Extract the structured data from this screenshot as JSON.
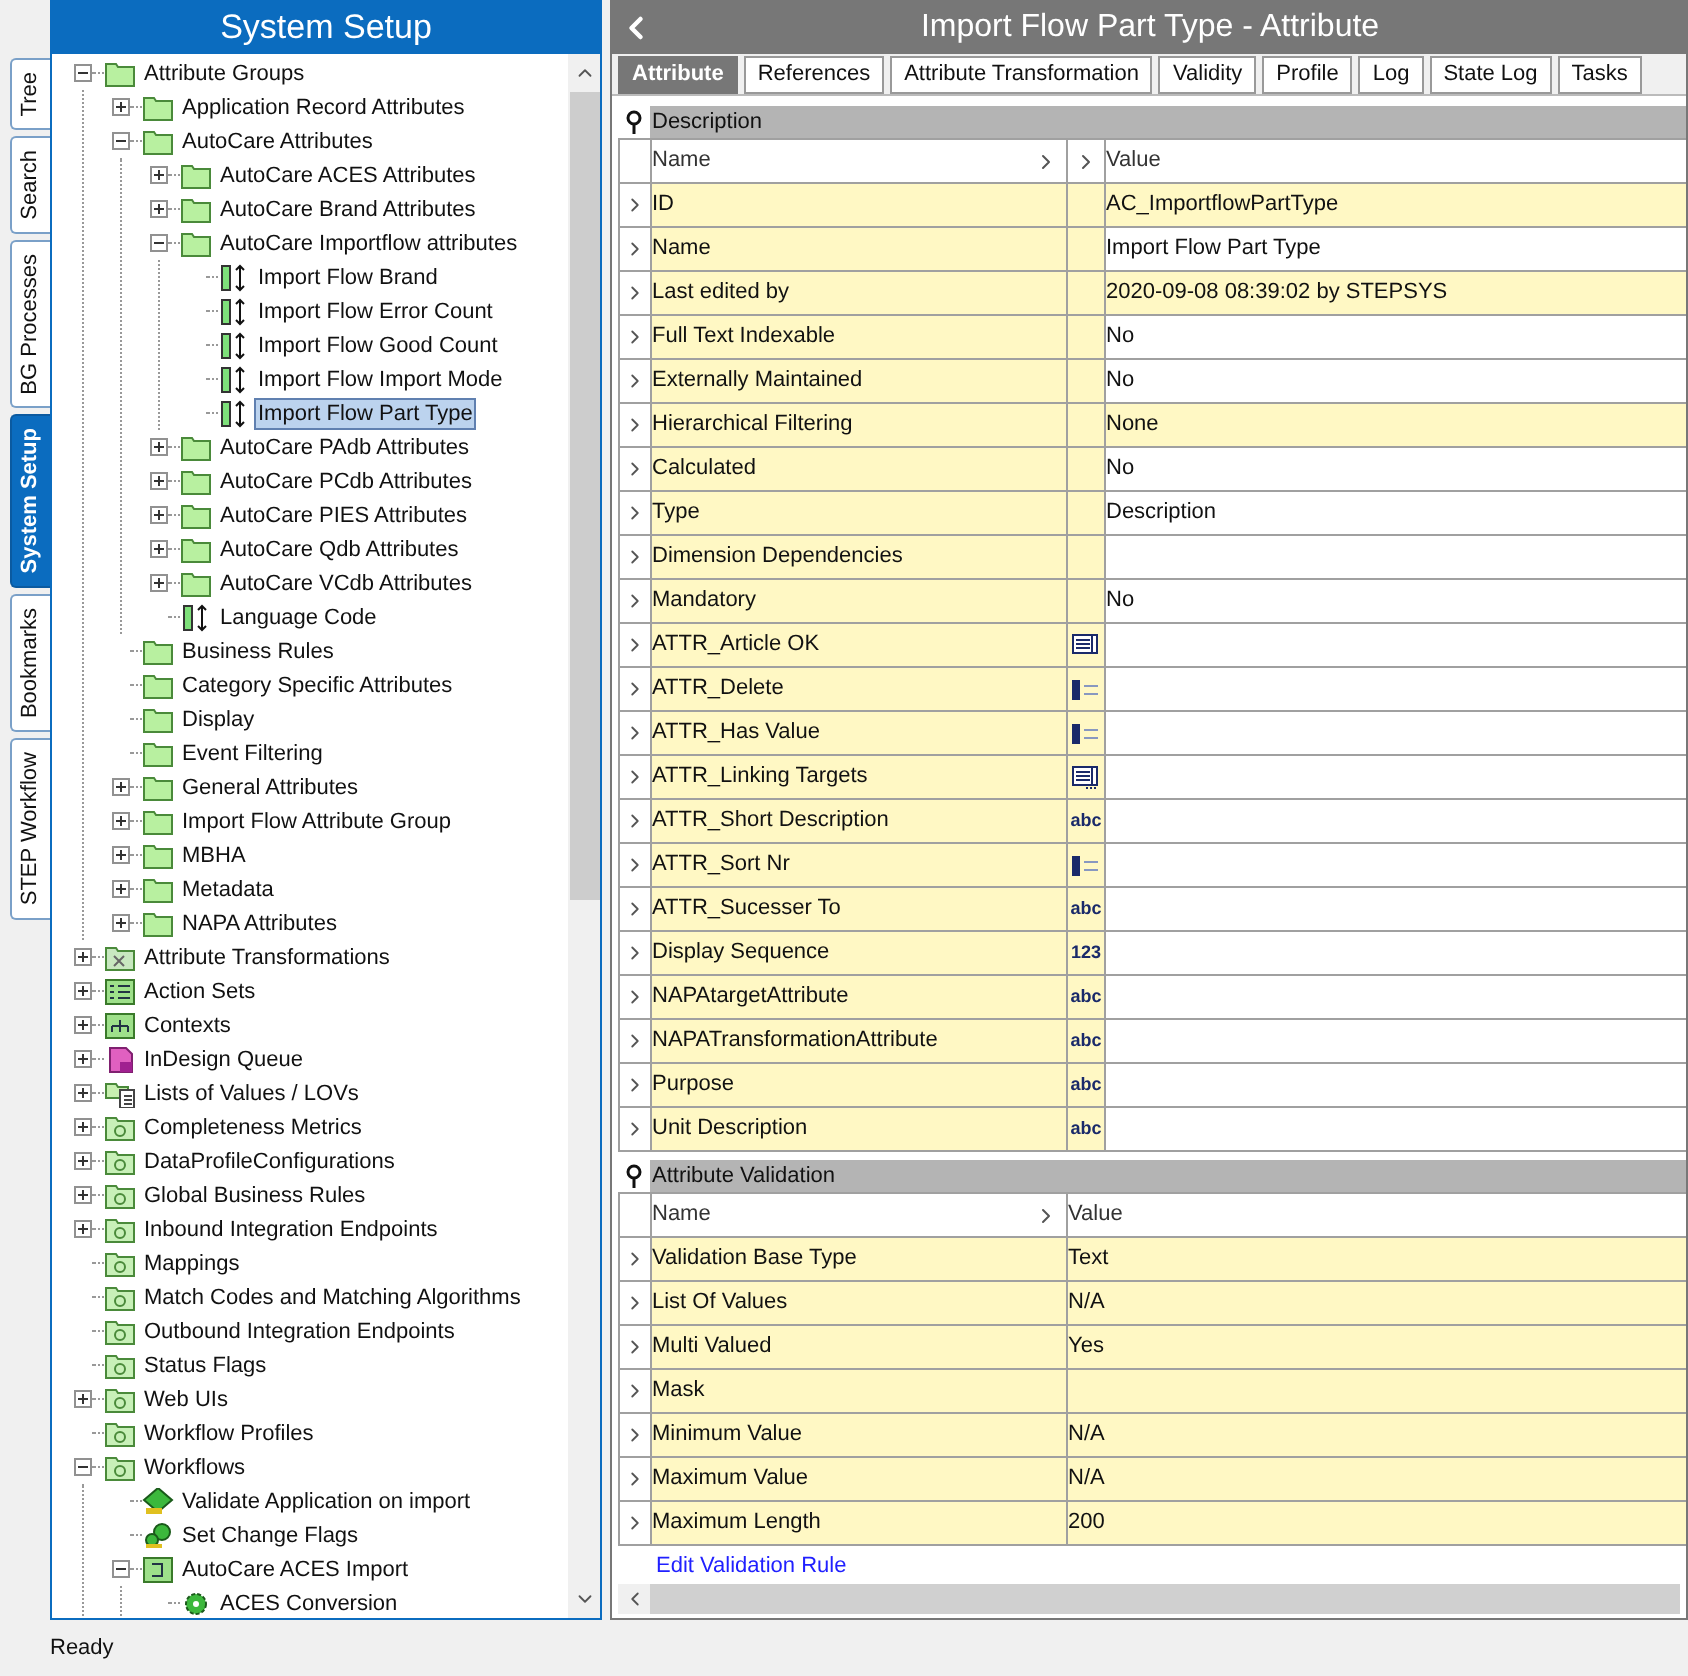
{
  "side_tabs": [
    {
      "label": "Tree",
      "selected": false
    },
    {
      "label": "Search",
      "selected": false
    },
    {
      "label": "BG Processes",
      "selected": false
    },
    {
      "label": "System Setup",
      "selected": true
    },
    {
      "label": "Bookmarks",
      "selected": false
    },
    {
      "label": "STEP Workflow",
      "selected": false
    }
  ],
  "tree_panel": {
    "title": "System Setup"
  },
  "tree": [
    {
      "label": "Attribute Groups",
      "kind": "folder",
      "expanded": true,
      "selected": false,
      "children": [
        {
          "label": "Application Record Attributes",
          "kind": "folder",
          "expanded": false,
          "selected": false
        },
        {
          "label": "AutoCare Attributes",
          "kind": "folder",
          "expanded": true,
          "selected": false,
          "children": [
            {
              "label": "AutoCare ACES Attributes",
              "kind": "folder",
              "expanded": false,
              "selected": false
            },
            {
              "label": "AutoCare Brand Attributes",
              "kind": "folder",
              "expanded": false,
              "selected": false
            },
            {
              "label": "AutoCare Importflow attributes",
              "kind": "folder",
              "expanded": true,
              "selected": false,
              "children": [
                {
                  "label": "Import Flow Brand",
                  "kind": "attribute",
                  "selected": false
                },
                {
                  "label": "Import Flow Error Count",
                  "kind": "attribute",
                  "selected": false
                },
                {
                  "label": "Import Flow Good Count",
                  "kind": "attribute",
                  "selected": false
                },
                {
                  "label": "Import Flow Import Mode",
                  "kind": "attribute",
                  "selected": false
                },
                {
                  "label": "Import Flow Part Type",
                  "kind": "attribute",
                  "selected": true
                }
              ]
            },
            {
              "label": "AutoCare PAdb Attributes",
              "kind": "folder",
              "expanded": false,
              "selected": false
            },
            {
              "label": "AutoCare PCdb Attributes",
              "kind": "folder",
              "expanded": false,
              "selected": false
            },
            {
              "label": "AutoCare PIES Attributes",
              "kind": "folder",
              "expanded": false,
              "selected": false
            },
            {
              "label": "AutoCare Qdb Attributes",
              "kind": "folder",
              "expanded": false,
              "selected": false
            },
            {
              "label": "AutoCare VCdb Attributes",
              "kind": "folder",
              "expanded": false,
              "selected": false
            },
            {
              "label": "Language Code",
              "kind": "attribute",
              "selected": false
            }
          ]
        },
        {
          "label": "Business Rules",
          "kind": "folder",
          "selected": false
        },
        {
          "label": "Category Specific Attributes",
          "kind": "folder",
          "selected": false
        },
        {
          "label": "Display",
          "kind": "folder",
          "selected": false
        },
        {
          "label": "Event Filtering",
          "kind": "folder",
          "selected": false
        },
        {
          "label": "General Attributes",
          "kind": "folder",
          "expanded": false,
          "selected": false
        },
        {
          "label": "Import Flow Attribute Group",
          "kind": "folder",
          "expanded": false,
          "selected": false
        },
        {
          "label": "MBHA",
          "kind": "folder",
          "expanded": false,
          "selected": false
        },
        {
          "label": "Metadata",
          "kind": "folder",
          "expanded": false,
          "selected": false
        },
        {
          "label": "NAPA Attributes",
          "kind": "folder",
          "expanded": false,
          "selected": false
        }
      ]
    },
    {
      "label": "Attribute Transformations",
      "kind": "transform",
      "expanded": false,
      "selected": false
    },
    {
      "label": "Action Sets",
      "kind": "checklist",
      "expanded": false,
      "selected": false
    },
    {
      "label": "Contexts",
      "kind": "hierarchy",
      "expanded": false,
      "selected": false
    },
    {
      "label": "InDesign Queue",
      "kind": "document",
      "expanded": false,
      "selected": false
    },
    {
      "label": "Lists of Values / LOVs",
      "kind": "list",
      "expanded": false,
      "selected": false
    },
    {
      "label": "Completeness Metrics",
      "kind": "setup",
      "expanded": false,
      "selected": false
    },
    {
      "label": "DataProfileConfigurations",
      "kind": "setup",
      "expanded": false,
      "selected": false
    },
    {
      "label": "Global Business Rules",
      "kind": "setup",
      "expanded": false,
      "selected": false
    },
    {
      "label": "Inbound Integration Endpoints",
      "kind": "setup",
      "expanded": false,
      "selected": false
    },
    {
      "label": "Mappings",
      "kind": "setup",
      "selected": false
    },
    {
      "label": "Match Codes and Matching Algorithms",
      "kind": "setup",
      "selected": false
    },
    {
      "label": "Outbound Integration Endpoints",
      "kind": "setup",
      "selected": false
    },
    {
      "label": "Status Flags",
      "kind": "setup",
      "selected": false
    },
    {
      "label": "Web UIs",
      "kind": "setup",
      "expanded": false,
      "selected": false
    },
    {
      "label": "Workflow Profiles",
      "kind": "setup",
      "selected": false
    },
    {
      "label": "Workflows",
      "kind": "setup",
      "expanded": true,
      "selected": false,
      "children": [
        {
          "label": "Validate Application on import",
          "kind": "diamond",
          "selected": false
        },
        {
          "label": "Set Change Flags",
          "kind": "gears",
          "selected": false
        },
        {
          "label": "AutoCare ACES Import",
          "kind": "process",
          "expanded": true,
          "selected": false,
          "children": [
            {
              "label": "ACES Conversion",
              "kind": "gear",
              "selected": false
            }
          ]
        }
      ]
    }
  ],
  "detail": {
    "title": "Import Flow Part Type - Attribute",
    "tabs": [
      {
        "label": "Attribute",
        "selected": true
      },
      {
        "label": "References",
        "selected": false
      },
      {
        "label": "Attribute Transformation",
        "selected": false
      },
      {
        "label": "Validity",
        "selected": false
      },
      {
        "label": "Profile",
        "selected": false
      },
      {
        "label": "Log",
        "selected": false
      },
      {
        "label": "State Log",
        "selected": false
      },
      {
        "label": "Tasks",
        "selected": false
      }
    ],
    "description": {
      "title": "Description",
      "columns": [
        "Name",
        "Value"
      ],
      "rows": [
        {
          "name": "ID",
          "value": "AC_ImportflowPartType",
          "highlighted": true
        },
        {
          "name": "Name",
          "value": "Import Flow Part Type",
          "highlighted": false
        },
        {
          "name": "Last edited by",
          "value": "2020-09-08 08:39:02 by STEPSYS",
          "highlighted": true
        },
        {
          "name": "Full Text Indexable",
          "value": "No",
          "highlighted": false
        },
        {
          "name": "Externally Maintained",
          "value": "No",
          "highlighted": false
        },
        {
          "name": "Hierarchical Filtering",
          "value": "None",
          "highlighted": true
        },
        {
          "name": "Calculated",
          "value": "No",
          "highlighted": false
        },
        {
          "name": "Type",
          "value": "Description",
          "highlighted": false
        },
        {
          "name": "Dimension Dependencies",
          "highlighted": false
        },
        {
          "name": "Mandatory",
          "value": "No",
          "highlighted": false
        },
        {
          "name": "ATTR_Article OK",
          "type": {
            "kind": "list"
          },
          "highlighted": false
        },
        {
          "name": "ATTR_Delete",
          "type": {
            "kind": "integer"
          },
          "highlighted": false
        },
        {
          "name": "ATTR_Has Value",
          "type": {
            "kind": "integer"
          },
          "highlighted": false
        },
        {
          "name": "ATTR_Linking Targets",
          "type": {
            "kind": "multilist"
          },
          "highlighted": false
        },
        {
          "name": "ATTR_Short Description",
          "type": {
            "kind": "badge",
            "label": "abc"
          },
          "highlighted": false
        },
        {
          "name": "ATTR_Sort Nr",
          "type": {
            "kind": "integer"
          },
          "highlighted": false
        },
        {
          "name": "ATTR_Sucesser To",
          "type": {
            "kind": "badge",
            "label": "abc"
          },
          "highlighted": false
        },
        {
          "name": "Display Sequence",
          "type": {
            "kind": "badge",
            "label": "123"
          },
          "highlighted": false
        },
        {
          "name": "NAPAtargetAttribute",
          "type": {
            "kind": "badge",
            "label": "abc"
          },
          "highlighted": false
        },
        {
          "name": "NAPATransformationAttribute",
          "type": {
            "kind": "badge",
            "label": "abc"
          },
          "highlighted": false
        },
        {
          "name": "Purpose",
          "type": {
            "kind": "badge",
            "label": "abc"
          },
          "highlighted": false
        },
        {
          "name": "Unit Description",
          "type": {
            "kind": "badge",
            "label": "abc"
          },
          "highlighted": false
        }
      ]
    },
    "validation": {
      "title": "Attribute Validation",
      "columns": [
        "Name",
        "Value"
      ],
      "rows": [
        {
          "name": "Validation Base Type",
          "value": "Text"
        },
        {
          "name": "List Of Values",
          "value": "N/A"
        },
        {
          "name": "Multi Valued",
          "value": "Yes"
        },
        {
          "name": "Mask"
        },
        {
          "name": "Minimum Value",
          "value": "N/A"
        },
        {
          "name": "Maximum Value",
          "value": "N/A"
        },
        {
          "name": "Maximum Length",
          "value": "200"
        }
      ],
      "link": "Edit Validation Rule"
    }
  },
  "status_bar": {
    "text": "Ready"
  }
}
